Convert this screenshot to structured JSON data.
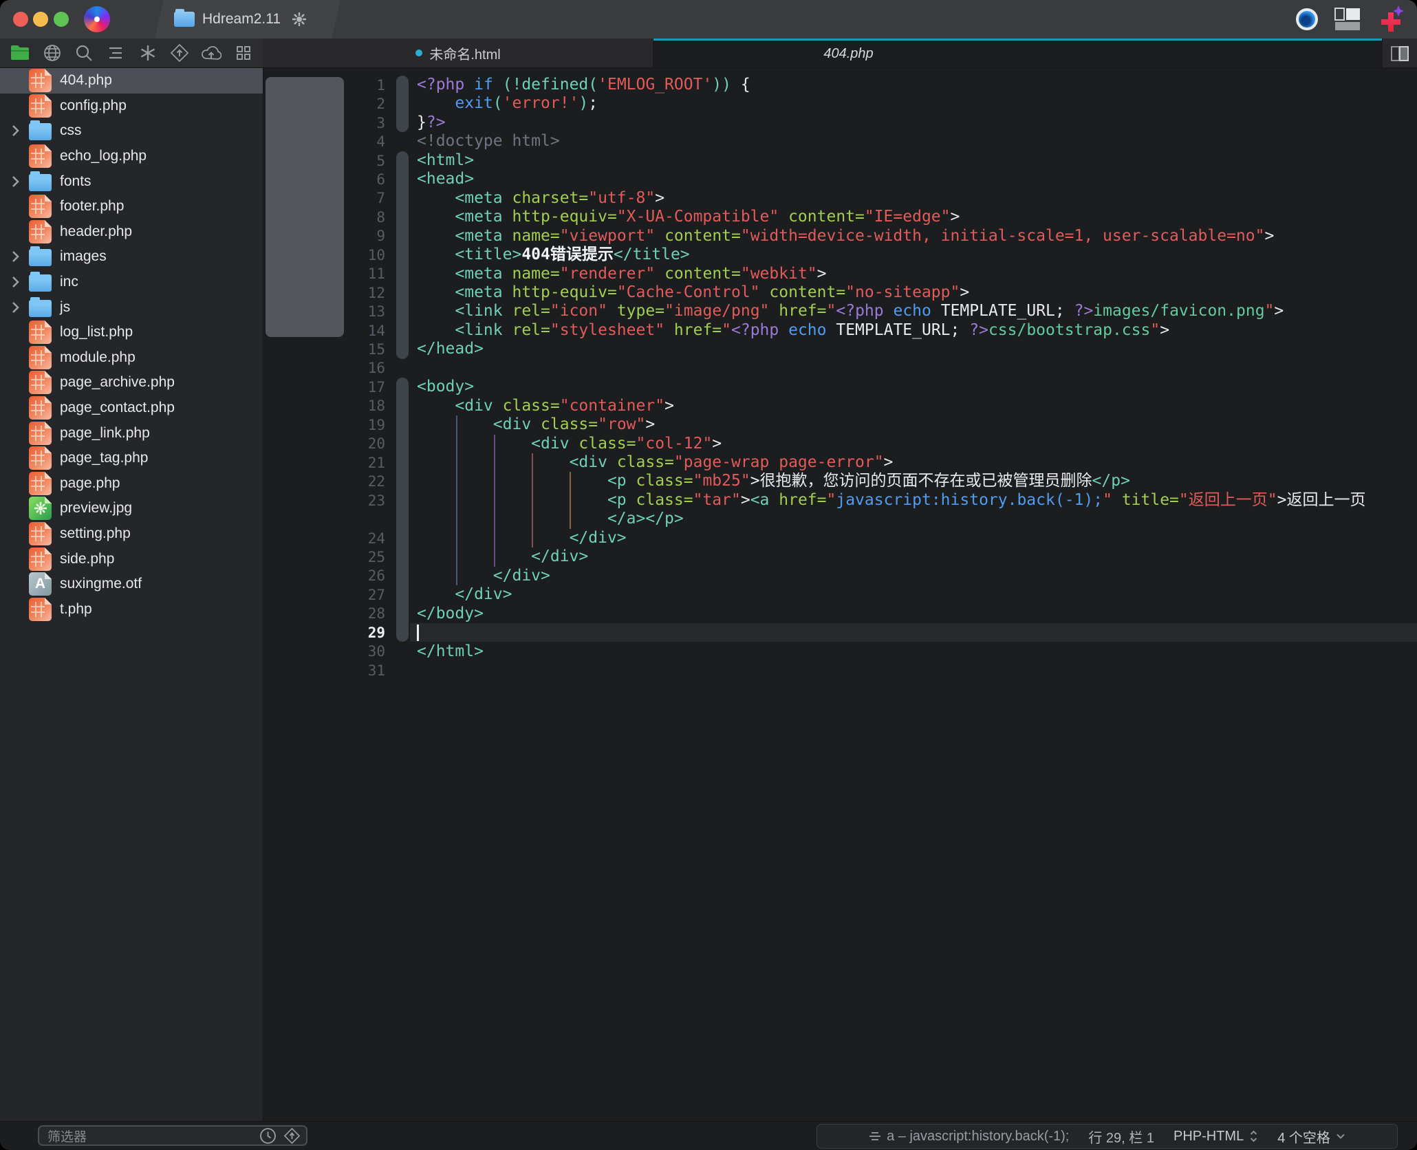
{
  "window": {
    "title": "Hdream2.11"
  },
  "titlebar": {
    "traffic_lights": [
      "close",
      "minimize",
      "zoom"
    ],
    "icons_right": [
      "preview-eye-icon",
      "layout-icon",
      "new-plus-icon"
    ]
  },
  "toolbar": {
    "icons": [
      "files-icon",
      "globe-icon",
      "search-icon",
      "navigator-icon",
      "snippets-icon",
      "publish-icon",
      "sync-icon",
      "grid-icon"
    ],
    "active_icon": "files-icon"
  },
  "tabs": [
    {
      "label": "未命名.html",
      "modified": true,
      "active": false
    },
    {
      "label": "404.php",
      "modified": false,
      "active": true
    }
  ],
  "sidebar": {
    "items": [
      {
        "type": "php",
        "label": "404.php",
        "selected": true
      },
      {
        "type": "php",
        "label": "config.php"
      },
      {
        "type": "folder",
        "label": "css"
      },
      {
        "type": "php",
        "label": "echo_log.php"
      },
      {
        "type": "folder",
        "label": "fonts"
      },
      {
        "type": "php",
        "label": "footer.php"
      },
      {
        "type": "php",
        "label": "header.php"
      },
      {
        "type": "folder",
        "label": "images"
      },
      {
        "type": "folder",
        "label": "inc"
      },
      {
        "type": "folder",
        "label": "js"
      },
      {
        "type": "php",
        "label": "log_list.php"
      },
      {
        "type": "php",
        "label": "module.php"
      },
      {
        "type": "php",
        "label": "page_archive.php"
      },
      {
        "type": "php",
        "label": "page_contact.php"
      },
      {
        "type": "php",
        "label": "page_link.php"
      },
      {
        "type": "php",
        "label": "page_tag.php"
      },
      {
        "type": "php",
        "label": "page.php"
      },
      {
        "type": "img",
        "label": "preview.jpg"
      },
      {
        "type": "php",
        "label": "setting.php"
      },
      {
        "type": "php",
        "label": "side.php"
      },
      {
        "type": "font",
        "label": "suxingme.otf"
      },
      {
        "type": "php",
        "label": "t.php"
      }
    ],
    "filter_placeholder": "筛选器"
  },
  "editor": {
    "cursor": {
      "line": 29,
      "col": 1
    },
    "lines": [
      {
        "n": 1,
        "segs": [
          [
            "php",
            "<?php "
          ],
          [
            "kw",
            "if "
          ],
          [
            "tag",
            "(!defined("
          ],
          [
            "str",
            "'EMLOG_ROOT'"
          ],
          [
            "tag",
            "))"
          ],
          [
            "pln",
            " {"
          ]
        ]
      },
      {
        "n": 2,
        "segs": [
          [
            "pln",
            "    "
          ],
          [
            "kw",
            "exit"
          ],
          [
            "tag",
            "("
          ],
          [
            "str",
            "'error!'"
          ],
          [
            "tag",
            ")"
          ],
          [
            "pln",
            ";"
          ]
        ]
      },
      {
        "n": 3,
        "segs": [
          [
            "pln",
            "}"
          ],
          [
            "php",
            "?>"
          ]
        ]
      },
      {
        "n": 4,
        "segs": [
          [
            "cmt",
            "<!doctype html>"
          ]
        ]
      },
      {
        "n": 5,
        "segs": [
          [
            "tag",
            "<html>"
          ]
        ]
      },
      {
        "n": 6,
        "segs": [
          [
            "tag",
            "<head>"
          ]
        ]
      },
      {
        "n": 7,
        "segs": [
          [
            "pln",
            "    "
          ],
          [
            "tag",
            "<meta "
          ],
          [
            "attr",
            "charset="
          ],
          [
            "str",
            "\"utf-8\""
          ],
          [
            "pln",
            ">"
          ]
        ]
      },
      {
        "n": 8,
        "segs": [
          [
            "pln",
            "    "
          ],
          [
            "tag",
            "<meta "
          ],
          [
            "attr",
            "http-equiv="
          ],
          [
            "str",
            "\"X-UA-Compatible\""
          ],
          [
            "pln",
            " "
          ],
          [
            "attr",
            "content="
          ],
          [
            "str",
            "\"IE=edge\""
          ],
          [
            "pln",
            ">"
          ]
        ]
      },
      {
        "n": 9,
        "segs": [
          [
            "pln",
            "    "
          ],
          [
            "tag",
            "<meta "
          ],
          [
            "attr",
            "name="
          ],
          [
            "str",
            "\"viewport\""
          ],
          [
            "pln",
            " "
          ],
          [
            "attr",
            "content="
          ],
          [
            "str",
            "\"width=device-width, initial-scale=1, user-scalable=no\""
          ],
          [
            "pln",
            ">"
          ]
        ]
      },
      {
        "n": 10,
        "segs": [
          [
            "pln",
            "    "
          ],
          [
            "tag",
            "<title>"
          ],
          [
            "ttl",
            "404错误提示"
          ],
          [
            "tag",
            "</title>"
          ]
        ]
      },
      {
        "n": 11,
        "segs": [
          [
            "pln",
            "    "
          ],
          [
            "tag",
            "<meta "
          ],
          [
            "attr",
            "name="
          ],
          [
            "str",
            "\"renderer\""
          ],
          [
            "pln",
            " "
          ],
          [
            "attr",
            "content="
          ],
          [
            "str",
            "\"webkit\""
          ],
          [
            "pln",
            ">"
          ]
        ]
      },
      {
        "n": 12,
        "segs": [
          [
            "pln",
            "    "
          ],
          [
            "tag",
            "<meta "
          ],
          [
            "attr",
            "http-equiv="
          ],
          [
            "str",
            "\"Cache-Control\""
          ],
          [
            "pln",
            " "
          ],
          [
            "attr",
            "content="
          ],
          [
            "str",
            "\"no-siteapp\""
          ],
          [
            "pln",
            ">"
          ]
        ]
      },
      {
        "n": 13,
        "segs": [
          [
            "pln",
            "    "
          ],
          [
            "tag",
            "<link "
          ],
          [
            "attr",
            "rel="
          ],
          [
            "str",
            "\"icon\""
          ],
          [
            "pln",
            " "
          ],
          [
            "attr",
            "type="
          ],
          [
            "str",
            "\"image/png\""
          ],
          [
            "pln",
            " "
          ],
          [
            "attr",
            "href="
          ],
          [
            "str",
            "\""
          ],
          [
            "php",
            "<?php "
          ],
          [
            "kw",
            "echo "
          ],
          [
            "pln",
            "TEMPLATE_URL; "
          ],
          [
            "php",
            "?>"
          ],
          [
            "path",
            "images/favicon.png"
          ],
          [
            "str",
            "\""
          ],
          [
            "pln",
            ">"
          ]
        ]
      },
      {
        "n": 14,
        "segs": [
          [
            "pln",
            "    "
          ],
          [
            "tag",
            "<link "
          ],
          [
            "attr",
            "rel="
          ],
          [
            "str",
            "\"stylesheet\""
          ],
          [
            "pln",
            " "
          ],
          [
            "attr",
            "href="
          ],
          [
            "str",
            "\""
          ],
          [
            "php",
            "<?php "
          ],
          [
            "kw",
            "echo "
          ],
          [
            "pln",
            "TEMPLATE_URL; "
          ],
          [
            "php",
            "?>"
          ],
          [
            "path",
            "css/bootstrap.css"
          ],
          [
            "str",
            "\""
          ],
          [
            "pln",
            ">"
          ]
        ]
      },
      {
        "n": 15,
        "segs": [
          [
            "tag",
            "</head>"
          ]
        ]
      },
      {
        "n": 16,
        "segs": []
      },
      {
        "n": 17,
        "segs": [
          [
            "tag",
            "<body>"
          ]
        ]
      },
      {
        "n": 18,
        "segs": [
          [
            "pln",
            "    "
          ],
          [
            "tag",
            "<div "
          ],
          [
            "attr",
            "class="
          ],
          [
            "str",
            "\"container\""
          ],
          [
            "pln",
            ">"
          ]
        ]
      },
      {
        "n": 19,
        "segs": [
          [
            "pln",
            "        "
          ],
          [
            "tag",
            "<div "
          ],
          [
            "attr",
            "class="
          ],
          [
            "str",
            "\"row\""
          ],
          [
            "pln",
            ">"
          ]
        ]
      },
      {
        "n": 20,
        "segs": [
          [
            "pln",
            "            "
          ],
          [
            "tag",
            "<div "
          ],
          [
            "attr",
            "class="
          ],
          [
            "str",
            "\"col-12\""
          ],
          [
            "pln",
            ">"
          ]
        ]
      },
      {
        "n": 21,
        "segs": [
          [
            "pln",
            "                "
          ],
          [
            "tag",
            "<div "
          ],
          [
            "attr",
            "class="
          ],
          [
            "str",
            "\"page-wrap page-error\""
          ],
          [
            "pln",
            ">"
          ]
        ]
      },
      {
        "n": 22,
        "segs": [
          [
            "pln",
            "                    "
          ],
          [
            "tag",
            "<p "
          ],
          [
            "attr",
            "class="
          ],
          [
            "str",
            "\"mb25\""
          ],
          [
            "pln",
            ">很抱歉，您访问的页面不存在或已被管理员删除"
          ],
          [
            "tag",
            "</p>"
          ]
        ]
      },
      {
        "n": 23,
        "segs": [
          [
            "pln",
            "                    "
          ],
          [
            "tag",
            "<p "
          ],
          [
            "attr",
            "class="
          ],
          [
            "str",
            "\"tar\""
          ],
          [
            "pln",
            ">"
          ],
          [
            "tag",
            "<a "
          ],
          [
            "attr",
            "href="
          ],
          [
            "str",
            "\""
          ],
          [
            "kw",
            "javascript:history.back(-1);"
          ],
          [
            "str",
            "\""
          ],
          [
            "pln",
            " "
          ],
          [
            "attr",
            "title="
          ],
          [
            "str",
            "\"返回上一页\""
          ],
          [
            "pln",
            ">返回上一页"
          ]
        ]
      },
      {
        "wrap": true,
        "segs": [
          [
            "pln",
            "                    "
          ],
          [
            "tag",
            "</a></p>"
          ]
        ]
      },
      {
        "n": 24,
        "segs": [
          [
            "pln",
            "                "
          ],
          [
            "tag",
            "</div>"
          ]
        ]
      },
      {
        "n": 25,
        "segs": [
          [
            "pln",
            "            "
          ],
          [
            "tag",
            "</div>"
          ]
        ]
      },
      {
        "n": 26,
        "segs": [
          [
            "pln",
            "        "
          ],
          [
            "tag",
            "</div>"
          ]
        ]
      },
      {
        "n": 27,
        "segs": [
          [
            "pln",
            "    "
          ],
          [
            "tag",
            "</div>"
          ]
        ]
      },
      {
        "n": 28,
        "segs": [
          [
            "tag",
            "</body>"
          ]
        ]
      },
      {
        "n": 29,
        "segs": []
      },
      {
        "n": 30,
        "segs": [
          [
            "tag",
            "</html>"
          ]
        ]
      },
      {
        "n": 31,
        "segs": []
      }
    ]
  },
  "statusbar": {
    "context": "a – javascript:history.back(-1);",
    "line_col": "行 29, 栏 1",
    "mode": "PHP-HTML",
    "indent": "4 个空格"
  },
  "colors": {
    "accent_teal": "#1599bb",
    "php_icon_orange": "#ec6236",
    "folder_blue": "#5baae7",
    "string_red": "#e25b5b",
    "keyword_blue": "#4f9df2",
    "tag_teal": "#6fd0ba",
    "attr_green": "#a2ce52",
    "php_delim_purple": "#9b7bd8"
  }
}
